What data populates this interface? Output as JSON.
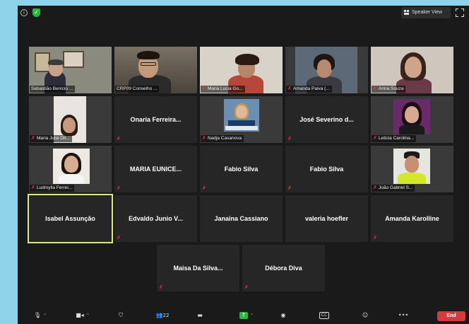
{
  "topbar": {
    "speaker_view_label": "Speaker View",
    "info_icon": "info-icon",
    "security_icon": "shield-check-icon"
  },
  "colors": {
    "background_frame": "#8fd3ea",
    "tile_bg": "#262626",
    "active_speaker_border": "#d9e88a",
    "muted_mic": "#e03b3b",
    "end_button": "#d63b3b",
    "secure_green": "#2fb344"
  },
  "participants": [
    {
      "label": "Sebastião Benicio ...",
      "video": true,
      "muted": false
    },
    {
      "label": "CRP09 Conselho ...",
      "video": true,
      "muted": false
    },
    {
      "label": "Maria Lucia Go...",
      "video": true,
      "muted": true
    },
    {
      "label": "Amanda Paiva (...",
      "video": true,
      "muted": true
    },
    {
      "label": "Anna Souza",
      "video": true,
      "muted": true
    },
    {
      "label": "Maria Julia Oli...",
      "video": true,
      "muted": true
    },
    {
      "label": "Onaria  Ferreira...",
      "video": false,
      "muted": true
    },
    {
      "label": "Nadja Casanova",
      "video": true,
      "muted": true
    },
    {
      "label": "José  Severino  d...",
      "video": false,
      "muted": true
    },
    {
      "label": "Leticia Carolina...",
      "video": true,
      "muted": true
    },
    {
      "label": "Ludmylla Ferrei...",
      "video": true,
      "muted": true
    },
    {
      "label": "MARIA  EUNICE...",
      "video": false,
      "muted": true
    },
    {
      "label": "Fabio Silva",
      "video": false,
      "muted": true
    },
    {
      "label": "Fabio Silva",
      "video": false,
      "muted": true
    },
    {
      "label": "João Gabriel S...",
      "video": true,
      "muted": true
    },
    {
      "label": "Isabel Assunção",
      "video": false,
      "muted": false
    },
    {
      "label": "Edvaldo  Junio  V...",
      "video": false,
      "muted": true
    },
    {
      "label": "Janaina Cassiano",
      "video": false,
      "muted": false
    },
    {
      "label": "valeria hoefler",
      "video": false,
      "muted": false
    },
    {
      "label": "Amanda Karolline",
      "video": false,
      "muted": true
    },
    {
      "label": "Maisa  Da  Silva...",
      "video": false,
      "muted": true
    },
    {
      "label": "Débora Diva",
      "video": false,
      "muted": true
    }
  ],
  "toolbar": {
    "mic_icon": "microphone-icon",
    "video_icon": "camera-icon",
    "security_icon": "shield-icon",
    "participants_icon": "participants-icon",
    "participants_count": "22",
    "chat_icon": "chat-icon",
    "share_icon": "share-screen-icon",
    "record_icon": "record-icon",
    "cc_icon": "closed-caption-icon",
    "cc_label": "CC",
    "reactions_icon": "reactions-icon",
    "more_icon": "more-icon",
    "more_label": "•••",
    "end_label": "End"
  }
}
